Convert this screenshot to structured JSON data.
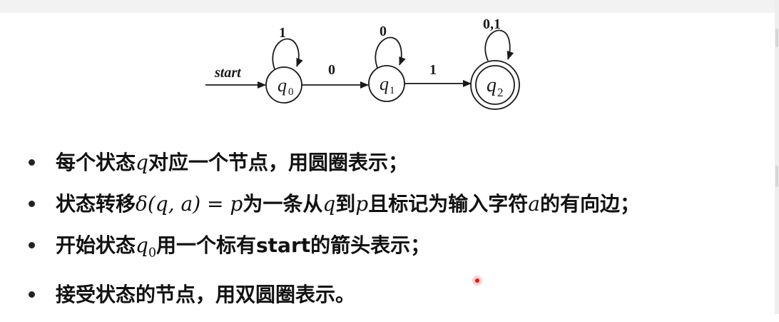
{
  "diagram": {
    "start_label": "start",
    "states": [
      {
        "id": "q0",
        "name": "q",
        "sub": "0",
        "accepting": false,
        "loop_label": "1"
      },
      {
        "id": "q1",
        "name": "q",
        "sub": "1",
        "accepting": false,
        "loop_label": "0"
      },
      {
        "id": "q2",
        "name": "q",
        "sub": "2",
        "accepting": true,
        "loop_label": "0,1"
      }
    ],
    "transitions": [
      {
        "from": "q0",
        "to": "q1",
        "label": "0"
      },
      {
        "from": "q1",
        "to": "q2",
        "label": "1"
      }
    ]
  },
  "bullets": [
    {
      "text_a": "每个状态",
      "math_a": "q",
      "text_b": "对应一个节点，用圆圈表示；"
    },
    {
      "text_a": "状态转移",
      "math_a": "δ(q, a) = p",
      "text_b": "为一条从",
      "math_b": "q",
      "text_c": "到",
      "math_c": "p",
      "text_d": "且标记为输入字符",
      "math_d": "a",
      "text_e": "的有向边；"
    },
    {
      "text_a": "开始状态",
      "math_a": "q",
      "math_a_sub": "0",
      "text_b": "用一个标有start的箭头表示；"
    },
    {
      "text_a": "接受状态的节点，用双圆圈表示。"
    }
  ],
  "colors": {
    "stroke": "#1a1a1a",
    "cursor": "#e21b1b"
  }
}
